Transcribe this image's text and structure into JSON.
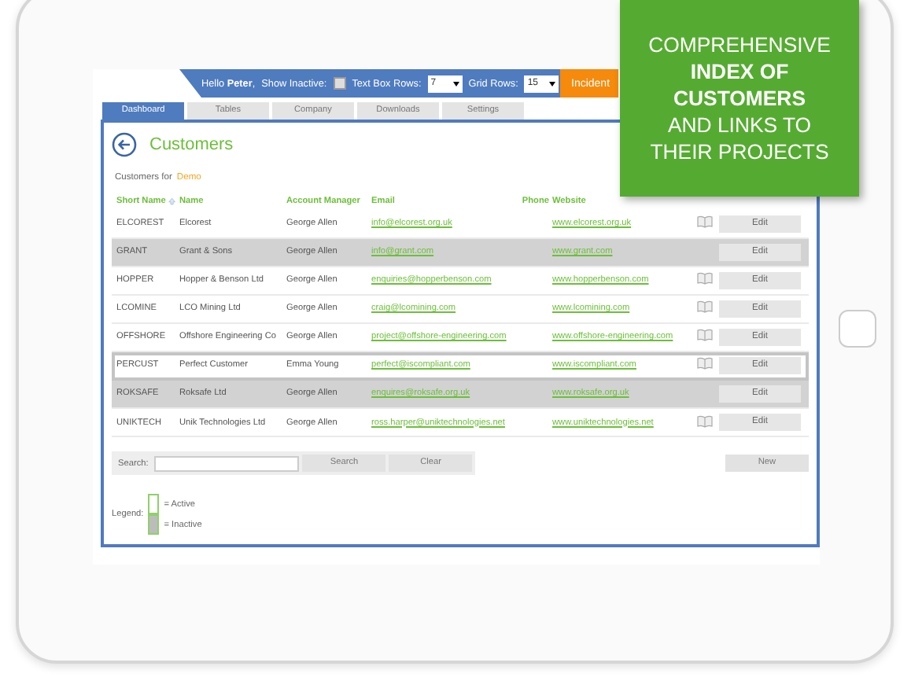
{
  "header": {
    "greeting": "Hello **Peter**,",
    "show_inactive": {
      "label": "Show Inactive:",
      "checked": false
    },
    "text_box_rows": {
      "label": "Text Box Rows:",
      "value": "7"
    },
    "grid_rows": {
      "label": "Grid Rows:",
      "value": "15"
    },
    "incident_button": "Incident"
  },
  "tabs": [
    {
      "label": "Dashboard",
      "selected": true
    },
    {
      "label": "Tables",
      "selected": false
    },
    {
      "label": "Company",
      "selected": false
    },
    {
      "label": "Downloads",
      "selected": false
    },
    {
      "label": "Settings",
      "selected": false
    }
  ],
  "page_title": "Customers",
  "subtitle": {
    "label": "Customers for",
    "owner": "Demo"
  },
  "table": {
    "columns": [
      "Short Name",
      "Name",
      "Account Manager",
      "Email",
      "Phone",
      "Website"
    ],
    "rows": [
      {
        "short_name": "ELCOREST",
        "name": "Elcorest",
        "manager": "George Allen",
        "email": "info@elcorest.org.uk",
        "website": "www.elcorest.org.uk",
        "active": true,
        "selected": false,
        "edit": "Edit"
      },
      {
        "short_name": "GRANT",
        "name": "Grant & Sons",
        "manager": "George Allen",
        "email": "info@grant.com",
        "website": "www.grant.com",
        "active": false,
        "selected": false,
        "edit": "Edit"
      },
      {
        "short_name": "HOPPER",
        "name": "Hopper & Benson Ltd",
        "manager": "George Allen",
        "email": "enquiries@hopperbenson.com",
        "website": "www.hopperbenson.com",
        "active": true,
        "selected": false,
        "edit": "Edit"
      },
      {
        "short_name": "LCOMINE",
        "name": "LCO Mining Ltd",
        "manager": "George Allen",
        "email": "craig@lcomining.com",
        "website": "www.lcomining.com",
        "active": true,
        "selected": false,
        "edit": "Edit"
      },
      {
        "short_name": "OFFSHORE",
        "name": "Offshore Engineering Co",
        "manager": "George Allen",
        "email": "project@offshore-engineering.com",
        "website": "www.offshore-engineering.com",
        "active": true,
        "selected": false,
        "edit": "Edit"
      },
      {
        "short_name": "PERCUST",
        "name": "Perfect Customer",
        "manager": "Emma Young",
        "email": "perfect@iscompliant.com",
        "website": "www.iscompliant.com",
        "active": true,
        "selected": true,
        "edit": "Edit"
      },
      {
        "short_name": "ROKSAFE",
        "name": "Roksafe Ltd",
        "manager": "George Allen",
        "email": "enquires@roksafe.org.uk",
        "website": "www.roksafe.org.uk",
        "active": false,
        "selected": false,
        "edit": "Edit"
      },
      {
        "short_name": "UNIKTECH",
        "name": "Unik Technologies Ltd",
        "manager": "George Allen",
        "email": "ross.harper@uniktechnologies.net",
        "website": "www.uniktechnologies.net",
        "active": true,
        "selected": false,
        "edit": "Edit"
      }
    ]
  },
  "search": {
    "label": "Search:",
    "search_button": "Search",
    "clear_button": "Clear"
  },
  "new_button": "New",
  "legend": {
    "label": "Legend:",
    "items": [
      {
        "label": "= Active",
        "kind": "active"
      },
      {
        "label": "= Inactive",
        "kind": "inactive"
      }
    ]
  },
  "callout": {
    "lines": [
      {
        "text": "COMPREHENSIVE",
        "bold": false
      },
      {
        "text": "INDEX OF",
        "bold": true
      },
      {
        "text": "CUSTOMERS",
        "bold": true
      },
      {
        "text": "AND LINKS TO",
        "bold": false
      },
      {
        "text": "THEIR PROJECTS",
        "bold": false
      }
    ]
  }
}
